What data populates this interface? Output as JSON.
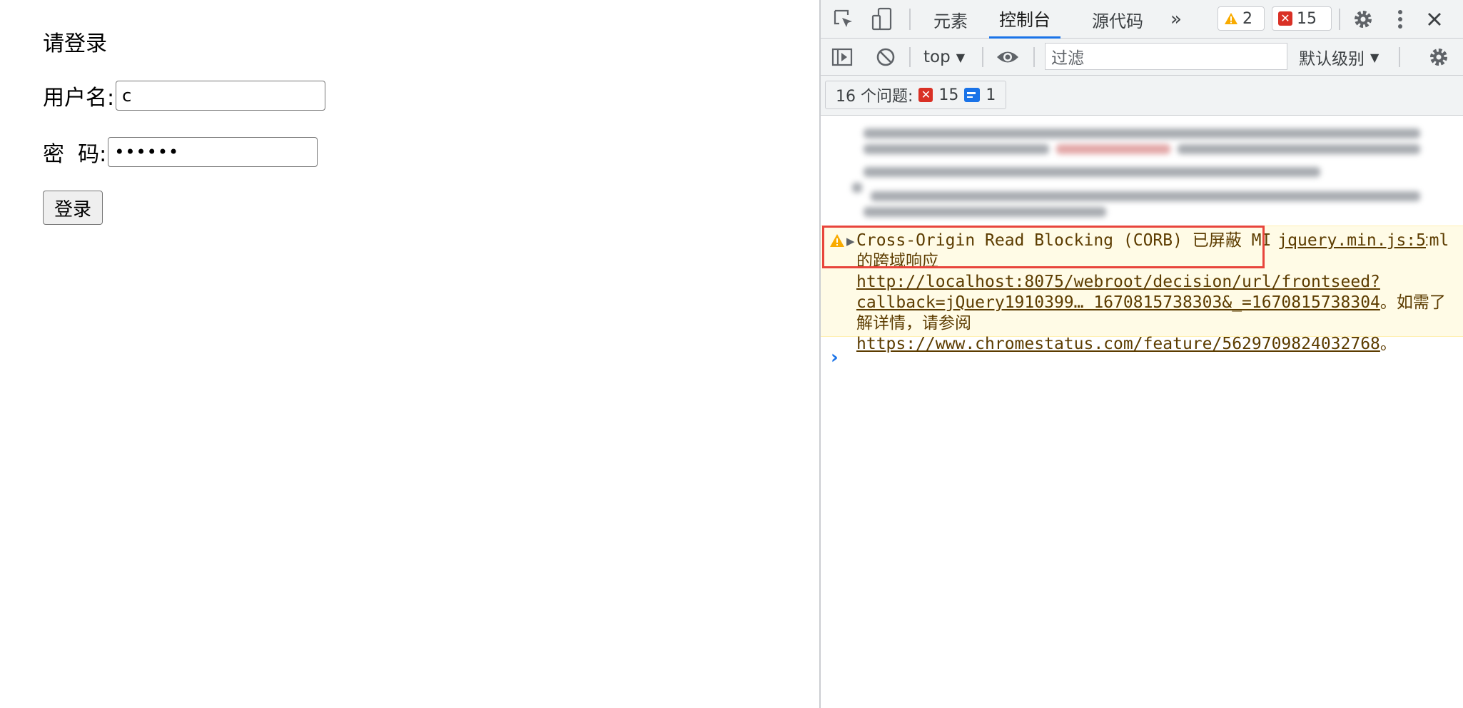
{
  "page": {
    "title": "请登录",
    "username_label": "用户名:",
    "username_value": "c",
    "password_label": "密  码:",
    "password_value": "••••••",
    "login_button": "登录"
  },
  "devtools": {
    "tabs": [
      {
        "label": "元素",
        "active": false
      },
      {
        "label": "控制台",
        "active": true
      },
      {
        "label": "源代码",
        "active": false
      }
    ],
    "more_tabs": "»",
    "warning_count": "2",
    "error_count": "15",
    "context": "top",
    "filter_placeholder": "过滤",
    "level": "默认级别",
    "issues": {
      "label": "16 个问题:",
      "errors": "15",
      "infos": "1"
    },
    "message": {
      "source": "jquery.min.js:5",
      "text_before": "Cross-Origin Read Blocking (CORB) 已屏蔽 MIME 类型为 text/html 的跨域响应 ",
      "url1": "http://localhost:8075/webroot/decision/url/frontseed?callback=jQuery1910399… 1670815738303&_=1670815738304",
      "text_middle": "。如需了解详情，请参阅 ",
      "url2": "https://www.chromestatus.com/feature/5629709824032768",
      "text_after": "。"
    },
    "colors": {
      "accent": "#1a73e8",
      "error": "#d93025",
      "warning": "#f9ab00",
      "highlight": "#e8453c"
    }
  }
}
